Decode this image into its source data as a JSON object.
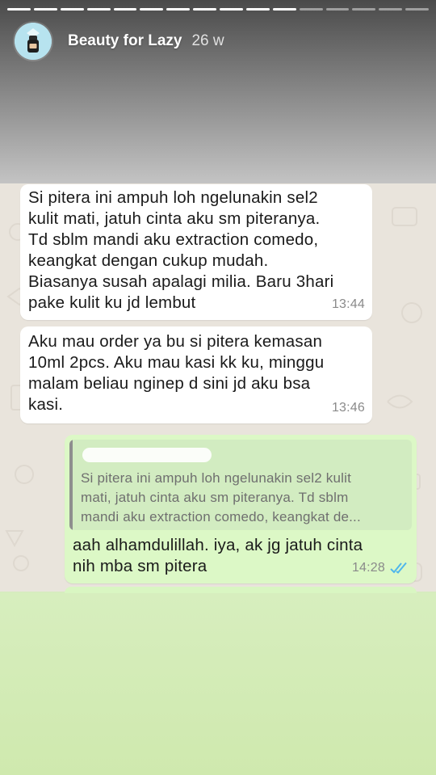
{
  "story": {
    "username": "Beauty for Lazy",
    "time_ago": "26 w",
    "progress_done_segments": 11,
    "progress_total_segments": 16
  },
  "messages": [
    {
      "direction": "incoming",
      "text": "Si pitera ini ampuh loh ngelunakin sel2\nkulit mati, jatuh cinta aku sm piteranya.\nTd sblm mandi aku extraction comedo,\nkeangkat dengan cukup mudah.\nBiasanya susah apalagi milia. Baru 3hari\npake kulit ku jd lembut",
      "time": "13:44"
    },
    {
      "direction": "incoming",
      "text": "Aku mau order ya bu si pitera kemasan\n10ml 2pcs. Aku mau kasi kk ku, minggu\nmalam beliau nginep d sini jd aku bsa\nkasi.",
      "time": "13:46"
    },
    {
      "direction": "outgoing",
      "quote_text": "Si pitera ini ampuh loh ngelunakin sel2 kulit\nmati, jatuh cinta aku sm piteranya. Td sblm\nmandi aku extraction comedo, keangkat de...",
      "text": "aah alhamdulillah. iya, ak jg jatuh cinta\nnih mba sm pitera",
      "time": "14:28"
    }
  ],
  "colors": {
    "incoming_bubble": "#ffffff",
    "outgoing_bubble": "#dcf8c6",
    "read_ticks": "#4fb6ec",
    "chat_background": "#e9e4dc"
  },
  "icons": [
    "avatar-logo-icon",
    "double-check-icon"
  ]
}
